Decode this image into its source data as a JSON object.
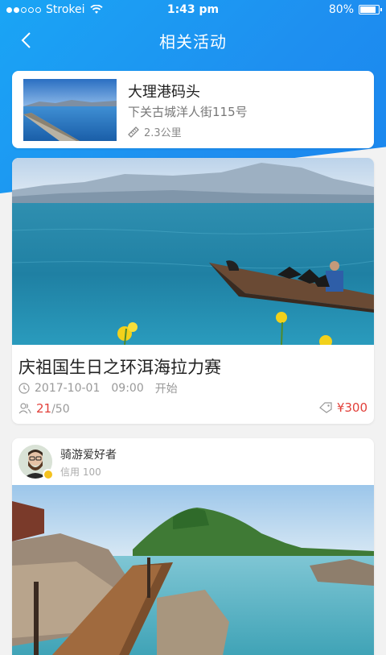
{
  "status": {
    "carrier": "Strokei",
    "time": "1:43 pm",
    "battery": "80%",
    "battery_level": 0.8
  },
  "nav": {
    "title": "相关活动",
    "back_icon": "chevron-left-icon"
  },
  "place": {
    "name": "大理港码头",
    "address": "下关古城洋人街115号",
    "distance": "2.3公里"
  },
  "event": {
    "title": "庆祖国生日之环洱海拉力赛",
    "date": "2017-10-01",
    "time": "09:00",
    "status": "开始",
    "current_count": "21",
    "capacity": "/50",
    "price": "¥300"
  },
  "post": {
    "user_name": "骑游爱好者",
    "credit": "信用 100"
  },
  "colors": {
    "header_blue": "#1e8ff0",
    "price_red": "#e2403a"
  }
}
